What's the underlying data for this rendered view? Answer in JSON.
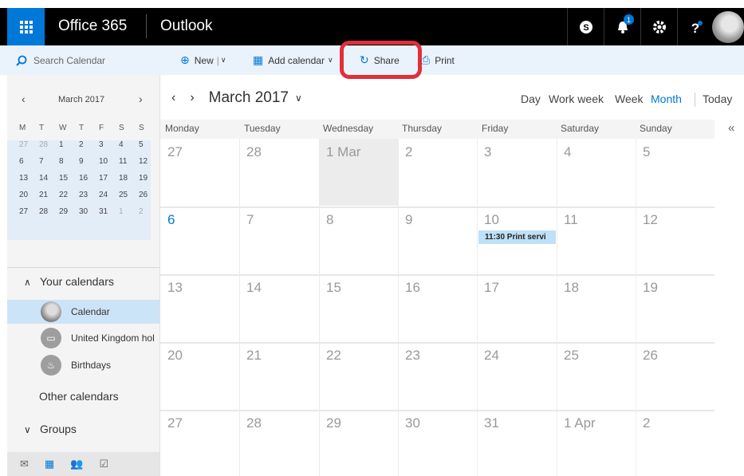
{
  "topbar": {
    "brand": "Office 365",
    "app": "Outlook",
    "notification_count": "1"
  },
  "commandbar": {
    "search_placeholder": "Search Calendar",
    "new_label": "New",
    "add_calendar_label": "Add calendar",
    "share_label": "Share",
    "print_label": "Print"
  },
  "minical": {
    "month": "March 2017",
    "weekday_headers": [
      "M",
      "T",
      "W",
      "T",
      "F",
      "S",
      "S"
    ],
    "weeks": [
      [
        "27",
        "28",
        "1",
        "2",
        "3",
        "4",
        "5"
      ],
      [
        "6",
        "7",
        "8",
        "9",
        "10",
        "11",
        "12"
      ],
      [
        "13",
        "14",
        "15",
        "16",
        "17",
        "18",
        "19"
      ],
      [
        "20",
        "21",
        "22",
        "23",
        "24",
        "25",
        "26"
      ],
      [
        "27",
        "28",
        "29",
        "30",
        "31",
        "1",
        "2"
      ]
    ]
  },
  "sidebar": {
    "your_calendars": "Your calendars",
    "calendars": [
      "Calendar",
      "United Kingdom hol",
      "Birthdays"
    ],
    "other_calendars": "Other calendars",
    "groups": "Groups"
  },
  "main": {
    "title": "March 2017",
    "views": [
      "Day",
      "Work week",
      "Week",
      "Month"
    ],
    "active_view": "Month",
    "today_label": "Today",
    "weekdays": [
      "Monday",
      "Tuesday",
      "Wednesday",
      "Thursday",
      "Friday",
      "Saturday",
      "Sunday"
    ],
    "weeks": [
      [
        "27",
        "28",
        "1 Mar",
        "2",
        "3",
        "4",
        "5"
      ],
      [
        "6",
        "7",
        "8",
        "9",
        "10",
        "11",
        "12"
      ],
      [
        "13",
        "14",
        "15",
        "16",
        "17",
        "18",
        "19"
      ],
      [
        "20",
        "21",
        "22",
        "23",
        "24",
        "25",
        "26"
      ],
      [
        "27",
        "28",
        "29",
        "30",
        "31",
        "1 Apr",
        "2"
      ]
    ],
    "event": "11:30 Print servi"
  },
  "colors": {
    "accent": "#0078d7",
    "highlight_ring": "#e0303a",
    "topbar": "#000000",
    "event_bg": "#bfe0f7"
  }
}
